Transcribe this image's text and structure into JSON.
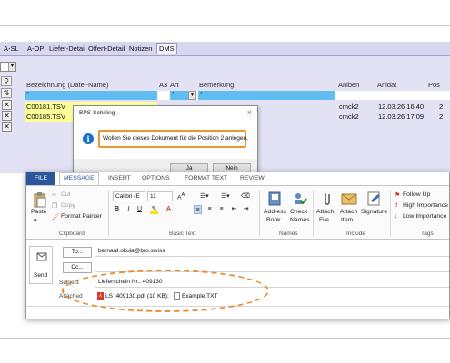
{
  "dms": {
    "tabs": [
      "A-SL",
      "A-OP",
      "Liefer-Detail",
      "Offert-Detail",
      "Notizen",
      "DMS"
    ],
    "columns": {
      "bezeichnung": "Bezeichnung (Datei-Name)",
      "a3": "A3",
      "art": "Art",
      "bemerkung": "Bemerkung",
      "anlben": "Anlben",
      "anldat": "Anldat",
      "pos": "Pos"
    },
    "filter_star": "*",
    "rows": [
      {
        "name": "C00181.TSV",
        "user": "cmck2",
        "date": "12.03.26 16:40",
        "pos": "2"
      },
      {
        "name": "C00185.TSV",
        "user": "cmck2",
        "date": "12.03.26 17:09",
        "pos": "2"
      }
    ]
  },
  "dialog": {
    "title": "BPS-Schilling",
    "close": "×",
    "icon": "info-icon",
    "message": "Wollen Sie dieses Dokument für die Position 2 anlegen.",
    "yes": "Ja",
    "no": "Nein"
  },
  "outlook": {
    "tabs": [
      "FILE",
      "MESSAGE",
      "INSERT",
      "OPTIONS",
      "FORMAT TEXT",
      "REVIEW"
    ],
    "clipboard": {
      "paste": "Paste",
      "cut": "Cut",
      "copy": "Copy",
      "format_painter": "Format Painter",
      "label": "Clipboard"
    },
    "basic_text": {
      "font": "Calibri (E",
      "size": "11",
      "label": "Basic Text"
    },
    "names": {
      "address_book_1": "Address",
      "address_book_2": "Book",
      "check_names_1": "Check",
      "check_names_2": "Names",
      "label": "Names"
    },
    "include": {
      "attach_file_1": "Attach",
      "attach_file_2": "File",
      "attach_item_1": "Attach",
      "attach_item_2": "Item",
      "signature_1": "Signature",
      "label": "Include"
    },
    "tags": {
      "follow_up": "Follow Up",
      "high": "High Importance",
      "low": "Low Importance",
      "label": "Tags"
    },
    "send": "Send",
    "to_label": "To...",
    "to_value": "bernard.okula@bro.swiss",
    "cc_label": "Cc...",
    "subject_label": "Subject",
    "subject_value": "Lieferschein Nr.: 409130",
    "attached_label": "Attached",
    "attachment_pdf": "LS_409130.pdf (10 KB);",
    "attachment_txt": "Example.TXT"
  },
  "colors": {
    "accent_orange": "#eb8c32",
    "outlook_blue": "#2b579a",
    "highlight_blue": "#5fbdf2",
    "row_yellow": "#ffff99"
  }
}
